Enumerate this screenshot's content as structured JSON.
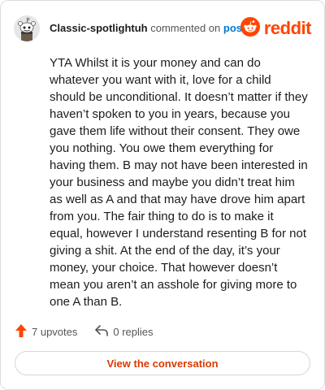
{
  "comment": {
    "username": "Classic-spotlightuh",
    "commented_on": "commented on",
    "post_link": "post",
    "body": "YTA Whilst it is your money and can do whatever you want with it, love for a child should be unconditional. It doesn’t matter if they haven’t spoken to you in years, because you gave them life without their consent. They owe you nothing. You owe them everything for having them. B may not have been interested in your business and maybe you didn’t treat him as well as A and that may have drove him apart from you. The fair thing to do is to make it equal, however I understand resenting B for not giving a shit. At the end of the day, it’s your money, your choice. That however doesn’t mean you aren’t an asshole for giving more to one A than B."
  },
  "brand": {
    "name": "reddit",
    "color": "#ff4500"
  },
  "stats": {
    "upvotes": "7 upvotes",
    "replies": "0 replies"
  },
  "cta": {
    "label": "View the conversation"
  },
  "icons": {
    "avatar": "snoo-avatar-icon",
    "brand": "reddit-logo-icon",
    "upvote": "upvote-arrow-icon",
    "reply": "reply-arrow-icon"
  }
}
